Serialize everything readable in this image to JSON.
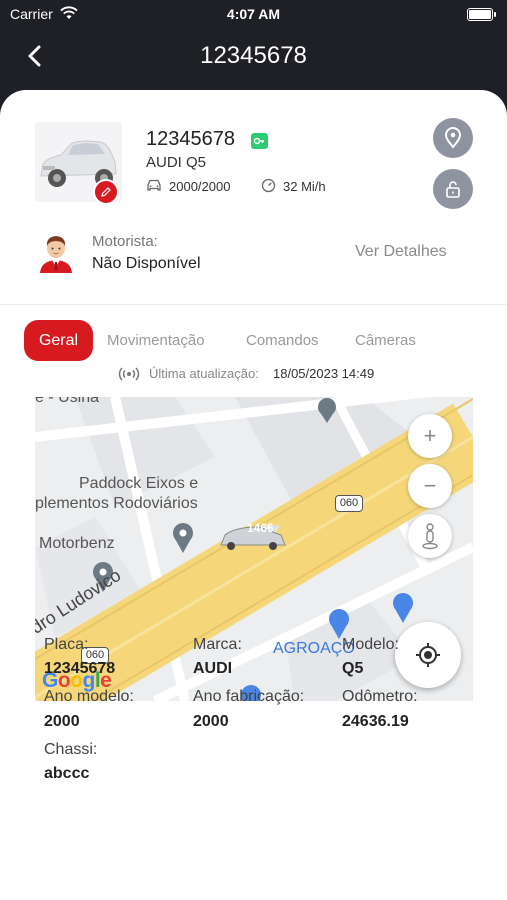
{
  "status_bar": {
    "carrier": "Carrier",
    "time": "4:07 AM"
  },
  "nav": {
    "title": "12345678"
  },
  "vehicle": {
    "plate": "12345678",
    "model": "AUDI Q5",
    "year": "2000/2000",
    "speed": "32 Mi/h"
  },
  "driver": {
    "label": "Motorista:",
    "value": "Não Disponível",
    "details_link": "Ver Detalhes"
  },
  "tabs": [
    {
      "label": "Geral",
      "active": true
    },
    {
      "label": "Movimentação",
      "active": false
    },
    {
      "label": "Comandos",
      "active": false
    },
    {
      "label": "Câmeras",
      "active": false
    }
  ],
  "update": {
    "label": "Última atualização:",
    "value": "18/05/2023 14:49"
  },
  "map": {
    "labels": {
      "usina": "e - Usina",
      "paddock_line1": "Paddock Eixos e",
      "paddock_line2": "plementos Rodoviários",
      "motorbenz": "Motorbenz",
      "street": "dro Ludovico",
      "agroaco": "AGROAÇO",
      "partial": "C    A"
    },
    "road_number": "060",
    "car_label": "1466",
    "google": "Google"
  },
  "details": {
    "placa": {
      "label": "Placa:",
      "value": "12345678"
    },
    "marca": {
      "label": "Marca:",
      "value": "AUDI"
    },
    "modelo": {
      "label": "Modelo:",
      "value": "Q5"
    },
    "ano_modelo": {
      "label": "Ano modelo:",
      "value": "2000"
    },
    "ano_fabricacao": {
      "label": "Ano fabricação:",
      "value": "2000"
    },
    "odometro": {
      "label": "Odômetro:",
      "value": "24636.19"
    },
    "chassi": {
      "label": "Chassi:",
      "value": "abccc"
    }
  },
  "colors": {
    "accent": "#d71920",
    "header_bg": "#1f2026",
    "key_badge": "#2ecc71",
    "road": "#f5d77a"
  }
}
